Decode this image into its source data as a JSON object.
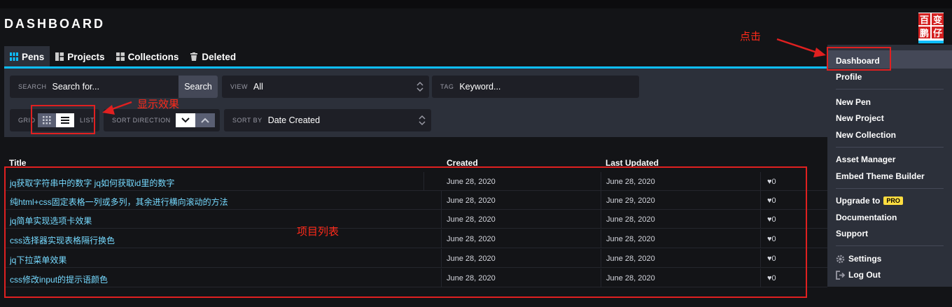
{
  "header": {
    "title": "DASHBOARD",
    "logo_chars": [
      "百",
      "变",
      "鹏",
      "仔"
    ]
  },
  "tabs": [
    {
      "label": "Pens",
      "icon": "pens-grid-icon",
      "active": true
    },
    {
      "label": "Projects",
      "icon": "projects-icon",
      "active": false
    },
    {
      "label": "Collections",
      "icon": "collections-icon",
      "active": false
    },
    {
      "label": "Deleted",
      "icon": "trash-icon",
      "active": false
    }
  ],
  "filters": {
    "search_label": "SEARCH",
    "search_placeholder": "Search for...",
    "search_button": "Search",
    "view_label": "VIEW",
    "view_value": "All",
    "tag_label": "TAG",
    "tag_placeholder": "Keyword...",
    "grid_label": "GRID",
    "list_label": "LIST",
    "sort_direction_label": "SORT DIRECTION",
    "sort_by_label": "SORT BY",
    "sort_by_value": "Date Created"
  },
  "table": {
    "columns": {
      "title": "Title",
      "created": "Created",
      "updated": "Last Updated"
    },
    "rows": [
      {
        "title": "jq获取字符串中的数字 jq如何获取id里的数字",
        "created": "June 28, 2020",
        "updated": "June 28, 2020",
        "hearts": "0"
      },
      {
        "title": "纯html+css固定表格一列或多列，其余进行横向滚动的方法",
        "created": "June 28, 2020",
        "updated": "June 29, 2020",
        "hearts": "0"
      },
      {
        "title": "jq简单实现选项卡效果",
        "created": "June 28, 2020",
        "updated": "June 28, 2020",
        "hearts": "0"
      },
      {
        "title": "css选择器实现表格隔行换色",
        "created": "June 28, 2020",
        "updated": "June 28, 2020",
        "hearts": "0"
      },
      {
        "title": "jq下拉菜单效果",
        "created": "June 28, 2020",
        "updated": "June 28, 2020",
        "hearts": "0"
      },
      {
        "title": "css修改input的提示语颜色",
        "created": "June 28, 2020",
        "updated": "June 28, 2020",
        "hearts": "0"
      }
    ]
  },
  "menu": {
    "dashboard": "Dashboard",
    "profile": "Profile",
    "new_pen": "New Pen",
    "new_project": "New Project",
    "new_collection": "New Collection",
    "asset_manager": "Asset Manager",
    "embed_theme_builder": "Embed Theme Builder",
    "upgrade": "Upgrade to",
    "pro_badge": "PRO",
    "documentation": "Documentation",
    "support": "Support",
    "settings": "Settings",
    "logout": "Log Out"
  },
  "annotations": {
    "click": "点击",
    "display_effect": "显示效果",
    "project_list": "项目列表"
  },
  "colors": {
    "accent": "#0ebeff",
    "link": "#76daff",
    "annotation": "#e02020",
    "pro": "#ffdd40"
  }
}
